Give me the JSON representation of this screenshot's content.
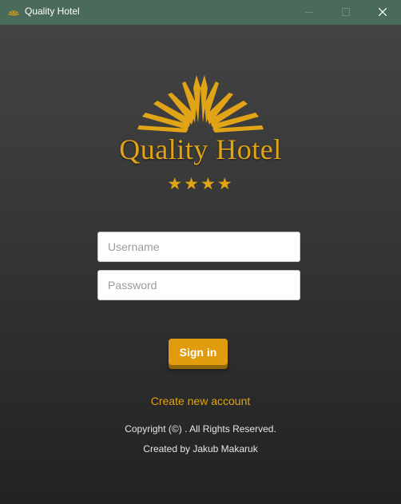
{
  "window": {
    "title": "Quality Hotel",
    "icon": "hotel-logo-icon",
    "controls": [
      "minimize-icon",
      "maximize-icon",
      "close-icon"
    ]
  },
  "logo": {
    "text": "Quality Hotel",
    "stars": "★★★★",
    "star_count": 4,
    "color": "#e0a416"
  },
  "form": {
    "username_placeholder": "Username",
    "username_value": "",
    "password_placeholder": "Password",
    "password_value": ""
  },
  "actions": {
    "signin_label": "Sign in",
    "create_account_label": "Create new account"
  },
  "footer": {
    "copyright": "Copyright (©) . All Rights Reserved.",
    "created_by": "Created by Jakub Makaruk"
  },
  "colors": {
    "titlebar": "#4a6a5a",
    "accent": "#e09b0f",
    "background_top": "#454545",
    "background_bottom": "#222222"
  }
}
